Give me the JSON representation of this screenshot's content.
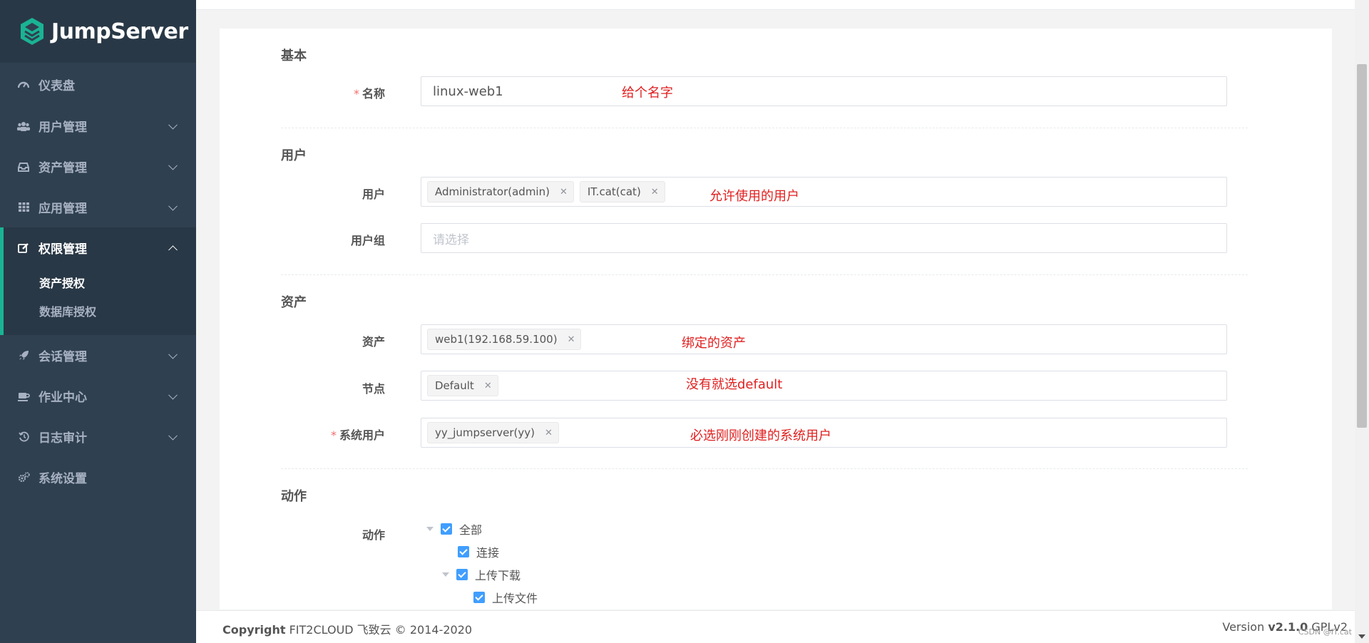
{
  "brand": {
    "name": "JumpServer",
    "accent": "#1ab394"
  },
  "sidebar": {
    "items": [
      {
        "label": "仪表盘",
        "icon": "dashboard-icon",
        "expandable": false
      },
      {
        "label": "用户管理",
        "icon": "users-icon",
        "expandable": true
      },
      {
        "label": "资产管理",
        "icon": "inbox-icon",
        "expandable": true
      },
      {
        "label": "应用管理",
        "icon": "grid-icon",
        "expandable": true
      },
      {
        "label": "权限管理",
        "icon": "edit-icon",
        "expandable": true,
        "expanded": true,
        "children": [
          {
            "label": "资产授权",
            "current": true
          },
          {
            "label": "数据库授权"
          }
        ]
      },
      {
        "label": "会话管理",
        "icon": "rocket-icon",
        "expandable": true
      },
      {
        "label": "作业中心",
        "icon": "coffee-icon",
        "expandable": true
      },
      {
        "label": "日志审计",
        "icon": "history-icon",
        "expandable": true
      },
      {
        "label": "系统设置",
        "icon": "gears-icon",
        "expandable": false
      }
    ]
  },
  "form": {
    "basic": {
      "title": "基本",
      "name_label": "名称",
      "name_value": "linux-web1",
      "name_note": "给个名字"
    },
    "user": {
      "title": "用户",
      "users_label": "用户",
      "users_tags": [
        "Administrator(admin)",
        "IT.cat(cat)"
      ],
      "users_note": "允许使用的用户",
      "groups_label": "用户组",
      "groups_placeholder": "请选择"
    },
    "asset": {
      "title": "资产",
      "assets_label": "资产",
      "assets_tags": [
        "web1(192.168.59.100)"
      ],
      "assets_note": "绑定的资产",
      "nodes_label": "节点",
      "nodes_tags": [
        "Default"
      ],
      "nodes_note": "没有就选default",
      "sysuser_label": "系统用户",
      "sysuser_tags": [
        "yy_jumpserver(yy)"
      ],
      "sysuser_note": "必选刚刚创建的系统用户"
    },
    "action": {
      "title": "动作",
      "label": "动作",
      "tree": [
        {
          "label": "全部",
          "checked": true
        },
        {
          "label": "连接",
          "checked": true
        },
        {
          "label": "上传下载",
          "checked": true
        },
        {
          "label": "上传文件",
          "checked": true
        }
      ]
    }
  },
  "footer": {
    "copyright_bold": "Copyright",
    "copyright_text": "FIT2CLOUD 飞致云 © 2014-2020",
    "version_prefix": "Version",
    "version_number": "v2.1.0",
    "license": "GPLv2"
  },
  "watermark": "CSDN @IT.cat"
}
